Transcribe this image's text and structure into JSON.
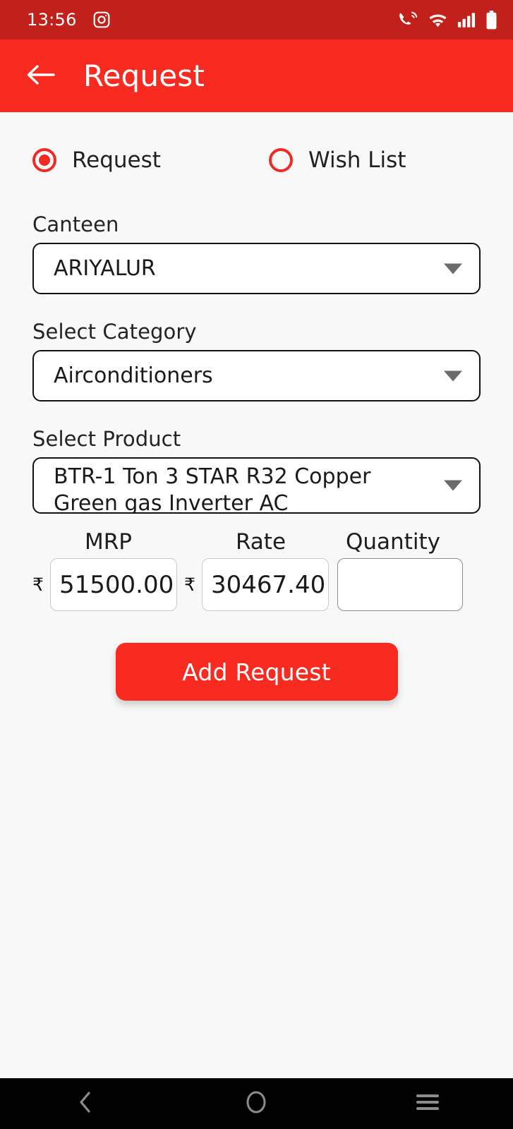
{
  "status_bar": {
    "time": "13:56",
    "notification_icon": "instagram-icon",
    "icons": [
      "call-waves-icon",
      "wifi-icon",
      "signal-bars-icon",
      "battery-icon"
    ],
    "background_color": "#c1211a"
  },
  "app_bar": {
    "back_icon": "back-arrow-icon",
    "title": "Request",
    "background_color": "#f92b20"
  },
  "mode_selector": {
    "options": [
      {
        "label": "Request",
        "selected": true
      },
      {
        "label": "Wish List",
        "selected": false
      }
    ],
    "accent_color": "#ef2b24"
  },
  "form": {
    "canteen": {
      "label": "Canteen",
      "value": "ARIYALUR"
    },
    "category": {
      "label": "Select Category",
      "value": "Airconditioners"
    },
    "product": {
      "label": "Select Product",
      "value": "BTR-1 Ton 3 STAR  R32 Copper Green gas Inverter AC"
    },
    "mrp": {
      "label": "MRP",
      "currency": "₹",
      "value": "51500.00"
    },
    "rate": {
      "label": "Rate",
      "currency": "₹",
      "value": "30467.40"
    },
    "quantity": {
      "label": "Quantity",
      "value": "",
      "placeholder": ""
    }
  },
  "actions": {
    "add_request_label": "Add Request",
    "button_color": "#f92b20"
  },
  "nav_bar": {
    "buttons": [
      "back-chevron-icon",
      "home-circle-icon",
      "recents-menu-icon"
    ],
    "background_color": "#000000"
  },
  "page": {
    "background_color": "#f8f8f8"
  }
}
